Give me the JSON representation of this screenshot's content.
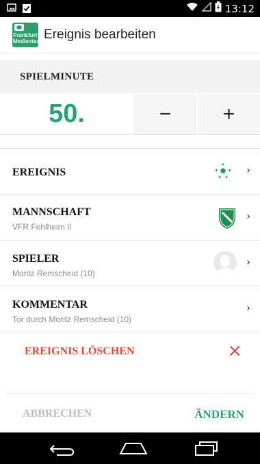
{
  "status_bar": {
    "time": "13:12",
    "icons": [
      "image-icon",
      "clipboard-check-icon",
      "wifi-icon",
      "signal-icon",
      "battery-charging-icon"
    ]
  },
  "action_bar": {
    "logo_text": "Frankfurt Medienteam",
    "title": "Ereignis bearbeiten"
  },
  "minute_section": {
    "header": "SPIELMINUTE",
    "value": "50.",
    "decrement_label": "−",
    "increment_label": "+"
  },
  "rows": [
    {
      "title": "EREIGNIS",
      "subtitle": "",
      "icon": "soccer-ball-icon"
    },
    {
      "title": "MANNSCHAFT",
      "subtitle": "VFR Fehlheim II",
      "icon": "club-crest-icon"
    },
    {
      "title": "SPIELER",
      "subtitle": "Moritz Remscheid (10)",
      "icon": "player-avatar-icon"
    },
    {
      "title": "KOMMENTAR",
      "subtitle": "Tor durch Moritz Remscheid (10)",
      "icon": ""
    }
  ],
  "chevron": "›",
  "delete": {
    "label": "EREIGNIS LÖSCHEN",
    "icon": "×"
  },
  "footer": {
    "cancel_label": "ABBRECHEN",
    "submit_label": "ÄNDERN"
  },
  "colors": {
    "accent_green": "#2aa176",
    "danger_red": "#e2473c",
    "disabled_gray": "#bdbdbd"
  }
}
